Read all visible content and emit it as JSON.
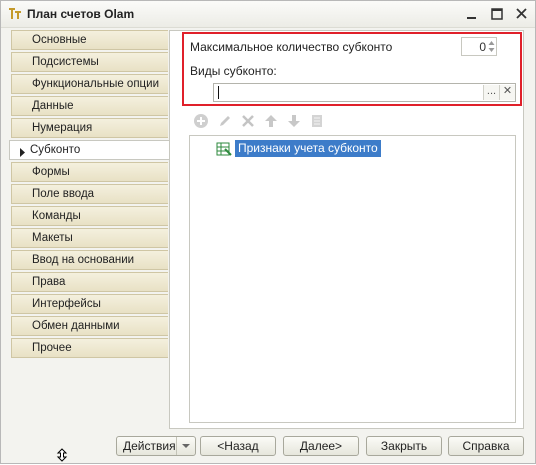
{
  "window": {
    "title": "План счетов Olam"
  },
  "tabs": [
    {
      "label": "Основные"
    },
    {
      "label": "Подсистемы"
    },
    {
      "label": "Функциональные опции"
    },
    {
      "label": "Данные"
    },
    {
      "label": "Нумерация"
    },
    {
      "label": "Субконто",
      "active": true
    },
    {
      "label": "Формы"
    },
    {
      "label": "Поле ввода"
    },
    {
      "label": "Команды"
    },
    {
      "label": "Макеты"
    },
    {
      "label": "Ввод на основании"
    },
    {
      "label": "Права"
    },
    {
      "label": "Интерфейсы"
    },
    {
      "label": "Обмен данными"
    },
    {
      "label": "Прочее"
    }
  ],
  "subconto": {
    "max_label": "Максимальное количество субконто",
    "max_value": "0",
    "types_label": "Виды субконто:",
    "types_value": "",
    "ellipsis": "...",
    "clear": "✕"
  },
  "tree": {
    "item": "Признаки учета субконто"
  },
  "buttons": {
    "actions": "Действия",
    "back": "<Назад",
    "next": "Далее>",
    "close": "Закрыть",
    "help": "Справка"
  },
  "colors": {
    "highlight": "#e0202a",
    "selection": "#3d7cc9",
    "tab_bg": "#ece6cc"
  }
}
